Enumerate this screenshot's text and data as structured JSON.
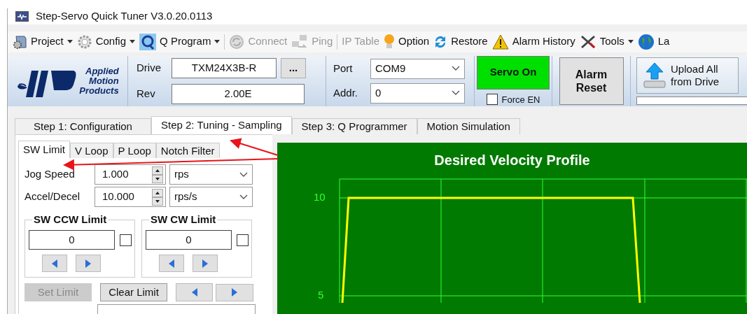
{
  "window": {
    "title": "Step-Servo Quick Tuner V3.0.20.0113"
  },
  "toolbar": [
    {
      "kind": "project",
      "label": "Project",
      "dropdown": true,
      "disabled": false
    },
    {
      "kind": "config",
      "label": "Config",
      "dropdown": true,
      "disabled": false
    },
    {
      "kind": "qprogram",
      "label": "Q Program",
      "dropdown": true,
      "disabled": false
    },
    {
      "kind": "separator"
    },
    {
      "kind": "connect",
      "label": "Connect",
      "dropdown": false,
      "disabled": true
    },
    {
      "kind": "ping",
      "label": "Ping",
      "dropdown": false,
      "disabled": true
    },
    {
      "kind": "separator"
    },
    {
      "kind": "none",
      "label": "IP Table",
      "dropdown": false,
      "disabled": true
    },
    {
      "kind": "option",
      "label": "Option",
      "dropdown": false,
      "disabled": false
    },
    {
      "kind": "restore",
      "label": "Restore",
      "dropdown": false,
      "disabled": false
    },
    {
      "kind": "alarm",
      "label": "Alarm History",
      "dropdown": false,
      "disabled": false
    },
    {
      "kind": "tools",
      "label": "Tools",
      "dropdown": true,
      "disabled": false
    },
    {
      "kind": "globe",
      "label": "La",
      "dropdown": false,
      "disabled": false
    }
  ],
  "logo": {
    "lines": [
      "Applied",
      "Motion",
      "Products"
    ]
  },
  "drive": {
    "label": "Drive",
    "value": "TXM24X3B-R",
    "button": "..."
  },
  "rev": {
    "label": "Rev",
    "value": "2.00E"
  },
  "port": {
    "label": "Port",
    "value": "COM9"
  },
  "addr": {
    "label": "Addr.",
    "value": "0"
  },
  "servo": {
    "label": "Servo On",
    "on": true
  },
  "force_en": {
    "label": "Force EN",
    "checked": false
  },
  "alarm_reset": {
    "label": "Alarm Reset"
  },
  "upload": {
    "label": "Upload All from Drive"
  },
  "tabs": [
    {
      "label": "Step 1: Configuration",
      "selected": false
    },
    {
      "label": "Step 2: Tuning - Sampling",
      "selected": true
    },
    {
      "label": "Step 3: Q Programmer",
      "selected": false
    },
    {
      "label": "Motion Simulation",
      "selected": false
    }
  ],
  "sub_tabs": [
    {
      "label": "SW Limit",
      "selected": true
    },
    {
      "label": "V Loop",
      "selected": false
    },
    {
      "label": "P Loop",
      "selected": false
    },
    {
      "label": "Notch Filter",
      "selected": false
    }
  ],
  "settings": [
    {
      "label": "Jog Speed",
      "value": "1.000",
      "unit": "rps"
    },
    {
      "label": "Accel/Decel",
      "value": "10.000",
      "unit": "rps/s"
    }
  ],
  "limits": [
    {
      "title": "SW CCW Limit",
      "value": "0",
      "checked": false
    },
    {
      "title": "SW CW Limit",
      "value": "0",
      "checked": false
    }
  ],
  "limit_buttons": [
    {
      "label": "Set Limit",
      "disabled": true
    },
    {
      "label": "Clear Limit",
      "disabled": false
    }
  ],
  "chart": {
    "title": "Desired Velocity Profile",
    "y_tick_labels": [
      "10",
      "5"
    ]
  }
}
